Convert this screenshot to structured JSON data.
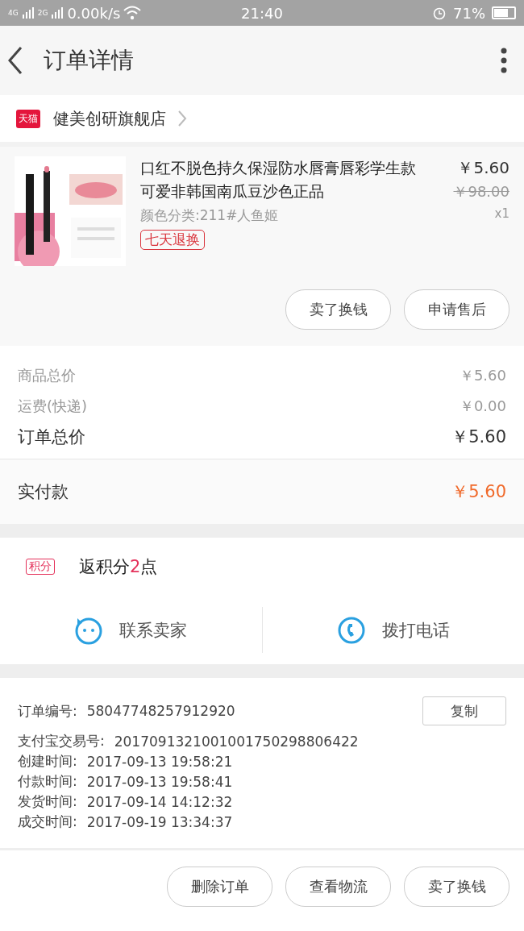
{
  "status_bar": {
    "networks": [
      "4G",
      "2G"
    ],
    "speed": "0.00k/s",
    "time": "21:40",
    "battery": "71%"
  },
  "header": {
    "title": "订单详情"
  },
  "store": {
    "badge": "天猫",
    "name": "健美创研旗舰店"
  },
  "product": {
    "image": {
      "kind": "picture"
    },
    "title": "口红不脱色持久保湿防水唇膏唇彩学生款可爱非韩国南瓜豆沙色正品",
    "variant": "颜色分类:211#人鱼姬",
    "tag": "七天退换",
    "price": "￥5.60",
    "original_price": "￥98.00",
    "quantity": "x1",
    "buttons": [
      "卖了换钱",
      "申请售后"
    ]
  },
  "summary": [
    {
      "label": "商品总价",
      "value": "￥5.60",
      "kind": "minor"
    },
    {
      "label": "运费(快递)",
      "value": "￥0.00",
      "kind": "minor"
    },
    {
      "label": "订单总价",
      "value": "￥5.60",
      "kind": "major"
    }
  ],
  "paid": {
    "label": "实付款",
    "value": "￥5.60"
  },
  "points": {
    "badge": "积分",
    "prefix": "返积分",
    "amount": "2",
    "suffix": "点"
  },
  "contact": [
    {
      "label": "联系卖家",
      "kind": "chat"
    },
    {
      "label": "拨打电话",
      "kind": "phone"
    }
  ],
  "order_info": {
    "copy_button": "复制",
    "lines": [
      {
        "label": "订单编号:",
        "value": "58047748257912920"
      },
      {
        "label": "支付宝交易号:",
        "value": "2017091321001001750298806422"
      },
      {
        "label": "创建时间:",
        "value": "2017-09-13 19:58:21"
      },
      {
        "label": "付款时间:",
        "value": "2017-09-13 19:58:41"
      },
      {
        "label": "发货时间:",
        "value": "2017-09-14 14:12:32"
      },
      {
        "label": "成交时间:",
        "value": "2017-09-19 13:34:37"
      }
    ]
  },
  "footer_buttons": [
    "删除订单",
    "查看物流",
    "卖了换钱"
  ]
}
